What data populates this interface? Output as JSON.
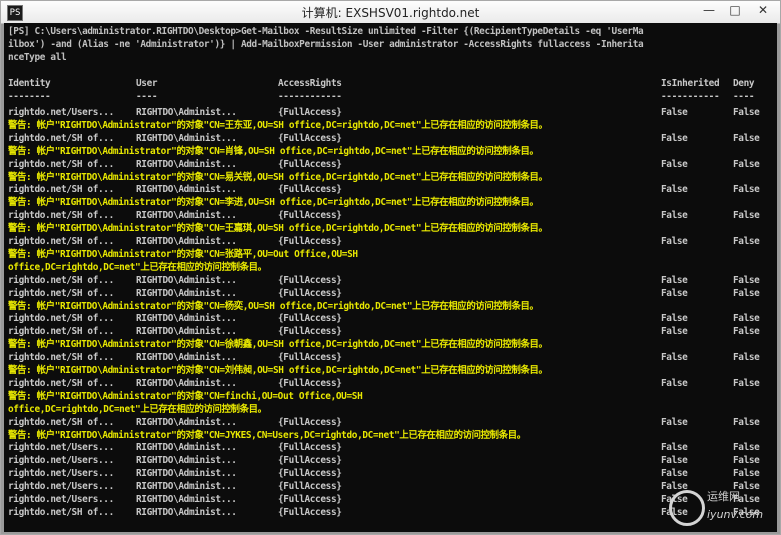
{
  "window": {
    "title": "计算机: EXSHSV01.rightdo.net",
    "icon_label": "PS"
  },
  "console": {
    "command_line1": "[PS] C:\\Users\\administrator.RIGHTDO\\Desktop>Get-Mailbox -ResultSize unlimited -Filter {(RecipientTypeDetails -eq 'UserMa",
    "command_line2": "ilbox') -and (Alias -ne 'Administrator')} | Add-MailboxPermission -User administrator -AccessRights fullaccess -Inherita",
    "command_line3": "nceType all",
    "headers": [
      "Identity",
      "User",
      "AccessRights",
      "IsInherited",
      "Deny"
    ],
    "underlines": [
      "--------",
      "----",
      "------------",
      "-----------",
      "----"
    ],
    "rows": [
      {
        "type": "row",
        "c1": "rightdo.net/Users...",
        "c2": "RIGHTDO\\Administ...",
        "c3": "{FullAccess}",
        "c4": "False",
        "c5": "False"
      },
      {
        "type": "warn",
        "text": "警告: 帐户\"RIGHTDO\\Administrator\"的对象\"CN=王东亚,OU=SH office,DC=rightdo,DC=net\"上已存在相应的访问控制条目。"
      },
      {
        "type": "row",
        "c1": "rightdo.net/SH of...",
        "c2": "RIGHTDO\\Administ...",
        "c3": "{FullAccess}",
        "c4": "False",
        "c5": "False"
      },
      {
        "type": "warn",
        "text": "警告: 帐户\"RIGHTDO\\Administrator\"的对象\"CN=肖锋,OU=SH office,DC=rightdo,DC=net\"上已存在相应的访问控制条目。"
      },
      {
        "type": "row",
        "c1": "rightdo.net/SH of...",
        "c2": "RIGHTDO\\Administ...",
        "c3": "{FullAccess}",
        "c4": "False",
        "c5": "False"
      },
      {
        "type": "warn",
        "text": "警告: 帐户\"RIGHTDO\\Administrator\"的对象\"CN=易关锐,OU=SH office,DC=rightdo,DC=net\"上已存在相应的访问控制条目。"
      },
      {
        "type": "row",
        "c1": "rightdo.net/SH of...",
        "c2": "RIGHTDO\\Administ...",
        "c3": "{FullAccess}",
        "c4": "False",
        "c5": "False"
      },
      {
        "type": "warn",
        "text": "警告: 帐户\"RIGHTDO\\Administrator\"的对象\"CN=李进,OU=SH office,DC=rightdo,DC=net\"上已存在相应的访问控制条目。"
      },
      {
        "type": "row",
        "c1": "rightdo.net/SH of...",
        "c2": "RIGHTDO\\Administ...",
        "c3": "{FullAccess}",
        "c4": "False",
        "c5": "False"
      },
      {
        "type": "warn",
        "text": "警告: 帐户\"RIGHTDO\\Administrator\"的对象\"CN=王嘉琪,OU=SH office,DC=rightdo,DC=net\"上已存在相应的访问控制条目。"
      },
      {
        "type": "row",
        "c1": "rightdo.net/SH of...",
        "c2": "RIGHTDO\\Administ...",
        "c3": "{FullAccess}",
        "c4": "False",
        "c5": "False"
      },
      {
        "type": "warn",
        "text": "警告: 帐户\"RIGHTDO\\Administrator\"的对象\"CN=张路平,OU=Out Office,OU=SH"
      },
      {
        "type": "warn",
        "text": "office,DC=rightdo,DC=net\"上已存在相应的访问控制条目。"
      },
      {
        "type": "row",
        "c1": "rightdo.net/SH of...",
        "c2": "RIGHTDO\\Administ...",
        "c3": "{FullAccess}",
        "c4": "False",
        "c5": "False"
      },
      {
        "type": "row",
        "c1": "rightdo.net/SH of...",
        "c2": "RIGHTDO\\Administ...",
        "c3": "{FullAccess}",
        "c4": "False",
        "c5": "False"
      },
      {
        "type": "warn",
        "text": "警告: 帐户\"RIGHTDO\\Administrator\"的对象\"CN=杨奕,OU=SH office,DC=rightdo,DC=net\"上已存在相应的访问控制条目。"
      },
      {
        "type": "row",
        "c1": "rightdo.net/SH of...",
        "c2": "RIGHTDO\\Administ...",
        "c3": "{FullAccess}",
        "c4": "False",
        "c5": "False"
      },
      {
        "type": "row",
        "c1": "rightdo.net/SH of...",
        "c2": "RIGHTDO\\Administ...",
        "c3": "{FullAccess}",
        "c4": "False",
        "c5": "False"
      },
      {
        "type": "warn",
        "text": "警告: 帐户\"RIGHTDO\\Administrator\"的对象\"CN=徐朝鑫,OU=SH office,DC=rightdo,DC=net\"上已存在相应的访问控制条目。"
      },
      {
        "type": "row",
        "c1": "rightdo.net/SH of...",
        "c2": "RIGHTDO\\Administ...",
        "c3": "{FullAccess}",
        "c4": "False",
        "c5": "False"
      },
      {
        "type": "warn",
        "text": "警告: 帐户\"RIGHTDO\\Administrator\"的对象\"CN=刘伟昶,OU=SH office,DC=rightdo,DC=net\"上已存在相应的访问控制条目。"
      },
      {
        "type": "row",
        "c1": "rightdo.net/SH of...",
        "c2": "RIGHTDO\\Administ...",
        "c3": "{FullAccess}",
        "c4": "False",
        "c5": "False"
      },
      {
        "type": "warn",
        "text": "警告: 帐户\"RIGHTDO\\Administrator\"的对象\"CN=finchi,OU=Out Office,OU=SH"
      },
      {
        "type": "warn",
        "text": "office,DC=rightdo,DC=net\"上已存在相应的访问控制条目。"
      },
      {
        "type": "row",
        "c1": "rightdo.net/SH of...",
        "c2": "RIGHTDO\\Administ...",
        "c3": "{FullAccess}",
        "c4": "False",
        "c5": "False"
      },
      {
        "type": "warn",
        "text": "警告: 帐户\"RIGHTDO\\Administrator\"的对象\"CN=JYKES,CN=Users,DC=rightdo,DC=net\"上已存在相应的访问控制条目。"
      },
      {
        "type": "row",
        "c1": "rightdo.net/Users...",
        "c2": "RIGHTDO\\Administ...",
        "c3": "{FullAccess}",
        "c4": "False",
        "c5": "False"
      },
      {
        "type": "row",
        "c1": "rightdo.net/Users...",
        "c2": "RIGHTDO\\Administ...",
        "c3": "{FullAccess}",
        "c4": "False",
        "c5": "False"
      },
      {
        "type": "row",
        "c1": "rightdo.net/Users...",
        "c2": "RIGHTDO\\Administ...",
        "c3": "{FullAccess}",
        "c4": "False",
        "c5": "False"
      },
      {
        "type": "row",
        "c1": "rightdo.net/Users...",
        "c2": "RIGHTDO\\Administ...",
        "c3": "{FullAccess}",
        "c4": "False",
        "c5": "False"
      },
      {
        "type": "row",
        "c1": "rightdo.net/Users...",
        "c2": "RIGHTDO\\Administ...",
        "c3": "{FullAccess}",
        "c4": "False",
        "c5": "False"
      },
      {
        "type": "row",
        "c1": "rightdo.net/SH of...",
        "c2": "RIGHTDO\\Administ...",
        "c3": "{FullAccess}",
        "c4": "False",
        "c5": "False"
      }
    ]
  },
  "watermark": {
    "brand_cn": "运维网",
    "url": "iyunv.com"
  },
  "colors": {
    "console_bg": "#0c0c0c",
    "text": "#c8c8c8",
    "warning": "#e8e800",
    "prompt": "#ffff55"
  }
}
